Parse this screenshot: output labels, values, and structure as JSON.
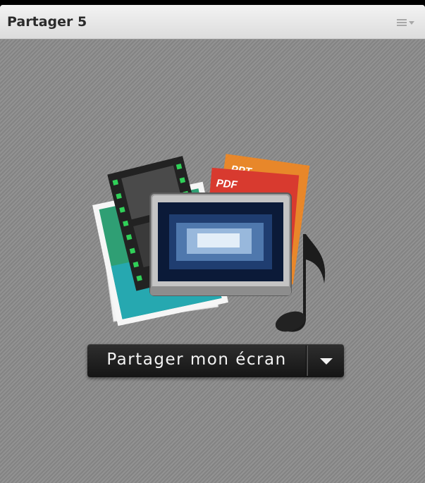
{
  "pod": {
    "title": "Partager 5",
    "menu_icon": "options-menu-icon"
  },
  "artwork": {
    "icon": "share-content-illustration",
    "doc_tags": [
      "PPT",
      "PDF"
    ]
  },
  "share": {
    "button_label": "Partager mon écran",
    "dropdown_icon": "caret-down-icon"
  },
  "colors": {
    "background": "#8a8a8a",
    "titlebar": "#e6e6e6",
    "button": "#1f1f1f",
    "ppt_tab": "#e8872a",
    "pdf_tab": "#d83a2f"
  }
}
